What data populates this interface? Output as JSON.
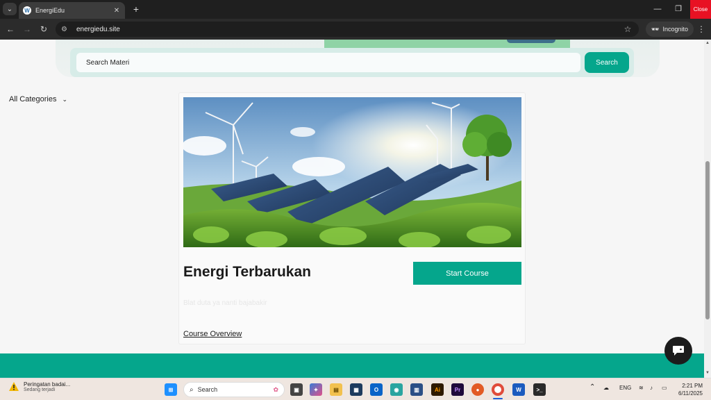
{
  "browser": {
    "tab_title": "EnergiEdu",
    "tab_favicon": "W",
    "url": "energiedu.site",
    "incognito_label": "Incognito",
    "close_label": "Close",
    "icons": {
      "tab_search": "chevron-down-icon",
      "new_tab": "plus-icon",
      "back": "arrow-left-icon",
      "forward": "arrow-right-icon",
      "reload": "reload-icon",
      "bookmark": "star-icon",
      "menu": "kebab-icon"
    }
  },
  "page": {
    "search": {
      "placeholder": "Search Materi",
      "button_label": "Search"
    },
    "categories_label": "All Categories",
    "course": {
      "title": "Energi Terbarukan",
      "start_label": "Start Course",
      "description": "Blat duta ya nanti bajabakir",
      "overview_link": "Course Overview"
    },
    "accent_color": "#05a68c"
  },
  "taskbar": {
    "weather_title": "Peringatan badai...",
    "weather_sub": "Sedang terjadi",
    "search_label": "Search",
    "language": "ENG",
    "time": "2:21 PM",
    "date": "6/11/2025",
    "apps": [
      "windows-start-icon",
      "task-view-icon",
      "copilot-icon",
      "file-explorer-icon",
      "store-icon",
      "outlook-icon",
      "edge-icon",
      "app-icon",
      "illustrator-icon",
      "premiere-icon",
      "firefox-icon",
      "chrome-icon",
      "word-icon",
      "terminal-icon"
    ],
    "app_labels": {
      "illustrator": "Ai",
      "premiere": "Pr",
      "word": "W",
      "outlook": "O"
    }
  }
}
